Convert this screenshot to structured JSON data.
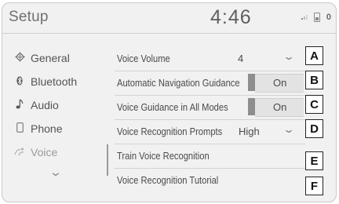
{
  "header": {
    "title": "Setup",
    "clock": "4:46",
    "status_icons": [
      "signal-icon",
      "phone-battery-icon"
    ],
    "status_badge": "0"
  },
  "sidebar": {
    "items": [
      {
        "label": "General",
        "icon": "gear-icon",
        "selected": false
      },
      {
        "label": "Bluetooth",
        "icon": "bluetooth-icon",
        "selected": false
      },
      {
        "label": "Audio",
        "icon": "music-note-icon",
        "selected": false
      },
      {
        "label": "Phone",
        "icon": "phone-icon",
        "selected": false
      },
      {
        "label": "Voice",
        "icon": "voice-icon",
        "selected": true
      }
    ],
    "more_icon": "chevron-down-icon"
  },
  "settings": {
    "rows": [
      {
        "label": "Voice Volume",
        "value": "4",
        "control": "dropdown",
        "key": "A"
      },
      {
        "label": "Automatic Navigation Guidance",
        "value": "On",
        "control": "toggle",
        "key": "B"
      },
      {
        "label": "Voice Guidance in All Modes",
        "value": "On",
        "control": "toggle",
        "key": "C"
      },
      {
        "label": "Voice Recognition Prompts",
        "value": "High",
        "control": "dropdown",
        "key": "D"
      },
      {
        "label": "Train Voice Recognition",
        "control": "none",
        "key": "E"
      },
      {
        "label": "Voice Recognition Tutorial",
        "control": "none",
        "key": "F"
      }
    ]
  }
}
